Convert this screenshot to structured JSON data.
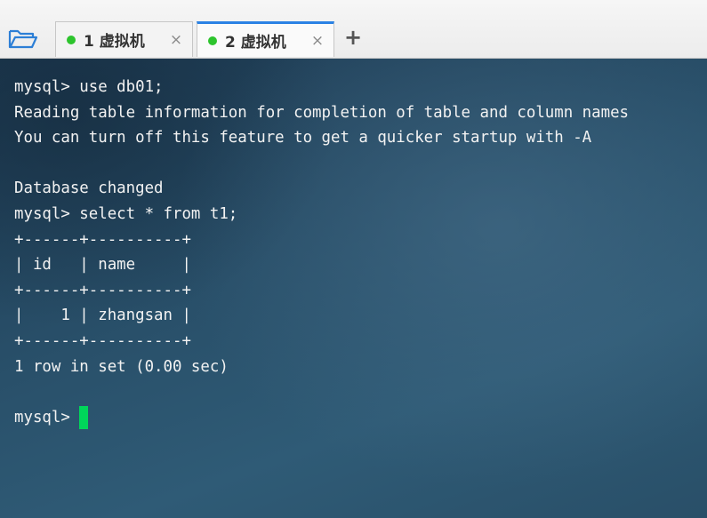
{
  "toolbar": {
    "folder_icon": "folder-open-icon"
  },
  "tabs": [
    {
      "label": "1 虚拟机",
      "status_color": "#2dc42d",
      "close_glyph": "×",
      "active": false
    },
    {
      "label": "2 虚拟机",
      "status_color": "#2dc42d",
      "close_glyph": "×",
      "active": true
    }
  ],
  "add_tab_glyph": "+",
  "terminal": {
    "lines": [
      "mysql> use db01;",
      "Reading table information for completion of table and column names",
      "You can turn off this feature to get a quicker startup with -A",
      "",
      "Database changed",
      "mysql> select * from t1;",
      "+------+----------+",
      "| id   | name     |",
      "+------+----------+",
      "|    1 | zhangsan |",
      "+------+----------+",
      "1 row in set (0.00 sec)",
      ""
    ],
    "prompt": "mysql>",
    "cursor_color": "#00d65a"
  }
}
